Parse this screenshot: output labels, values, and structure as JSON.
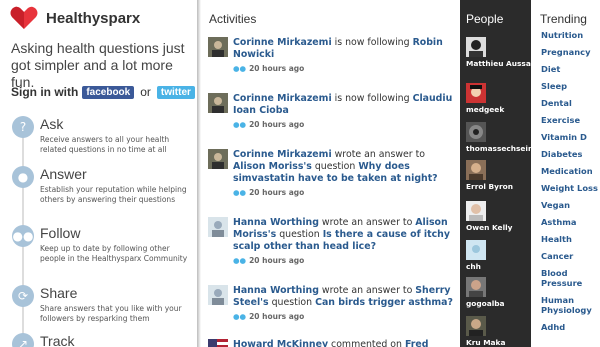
{
  "brand": {
    "name": "Healthysparx",
    "accent": "#e8343c"
  },
  "tagline": "Asking health questions just got simpler and a lot more fun.",
  "signin": {
    "label": "Sign in with",
    "facebook": "facebook",
    "or": "or",
    "twitter": "twitter"
  },
  "steps": [
    {
      "icon": "question-icon",
      "title": "Ask",
      "desc": "Receive answers to all your health related questions in no time at all"
    },
    {
      "icon": "person-icon",
      "title": "Answer",
      "desc": "Establish your reputation while helping others by answering their questions"
    },
    {
      "icon": "group-icon",
      "title": "Follow",
      "desc": "Keep up to date by following other people in the Healthysparx Community"
    },
    {
      "icon": "resparx-icon",
      "title": "Share",
      "desc": "Share answers that you like with your followers by resparking them"
    },
    {
      "icon": "track-icon",
      "title": "Track",
      "desc": ""
    }
  ],
  "activities": {
    "heading": "Activities",
    "items": [
      {
        "actor": "Corinne Mirkazemi",
        "verb": " is now following ",
        "object": "Robin Nowicki",
        "tail": "",
        "tail_link": "",
        "time": "20 hours ago"
      },
      {
        "actor": "Corinne Mirkazemi",
        "verb": " is now following ",
        "object": "Claudiu Ioan Cioba",
        "tail": "",
        "tail_link": "",
        "time": "20 hours ago"
      },
      {
        "actor": "Corinne Mirkazemi",
        "verb": " wrote an answer to ",
        "object": "Alison Moriss's",
        "tail": " question ",
        "tail_link": "Why does simvastatin have to be taken at night?",
        "time": "20 hours ago"
      },
      {
        "actor": "Hanna Worthing",
        "verb": " wrote an answer to ",
        "object": "Alison Moriss's",
        "tail": " question ",
        "tail_link": "Is there a cause of itchy scalp other than head lice?",
        "time": "20 hours ago"
      },
      {
        "actor": "Hanna Worthing",
        "verb": " wrote an answer to ",
        "object": "Sherry Steel's",
        "tail": " question ",
        "tail_link": "Can birds trigger asthma?",
        "time": "20 hours ago"
      },
      {
        "actor": "Howard McKinney",
        "verb": " commented on ",
        "object": "Fred Penn's",
        "tail": "",
        "tail_link": "",
        "time": ""
      }
    ]
  },
  "people": {
    "heading": "People",
    "list": [
      "Matthieu Aussaguel",
      "medgeek",
      "thomassechseins",
      "Errol Byron",
      "Owen Kelly",
      "chh",
      "gogoalba",
      "Kru Maka"
    ]
  },
  "trending": {
    "heading": "Trending",
    "topics": [
      "Nutrition",
      "Pregnancy",
      "Diet",
      "Sleep",
      "Dental",
      "Exercise",
      "Vitamin D",
      "Diabetes",
      "Medication",
      "Weight Loss",
      "Vegan",
      "Asthma",
      "Health",
      "Cancer",
      "Blood Pressure",
      "Human Physiology",
      "Adhd"
    ]
  }
}
